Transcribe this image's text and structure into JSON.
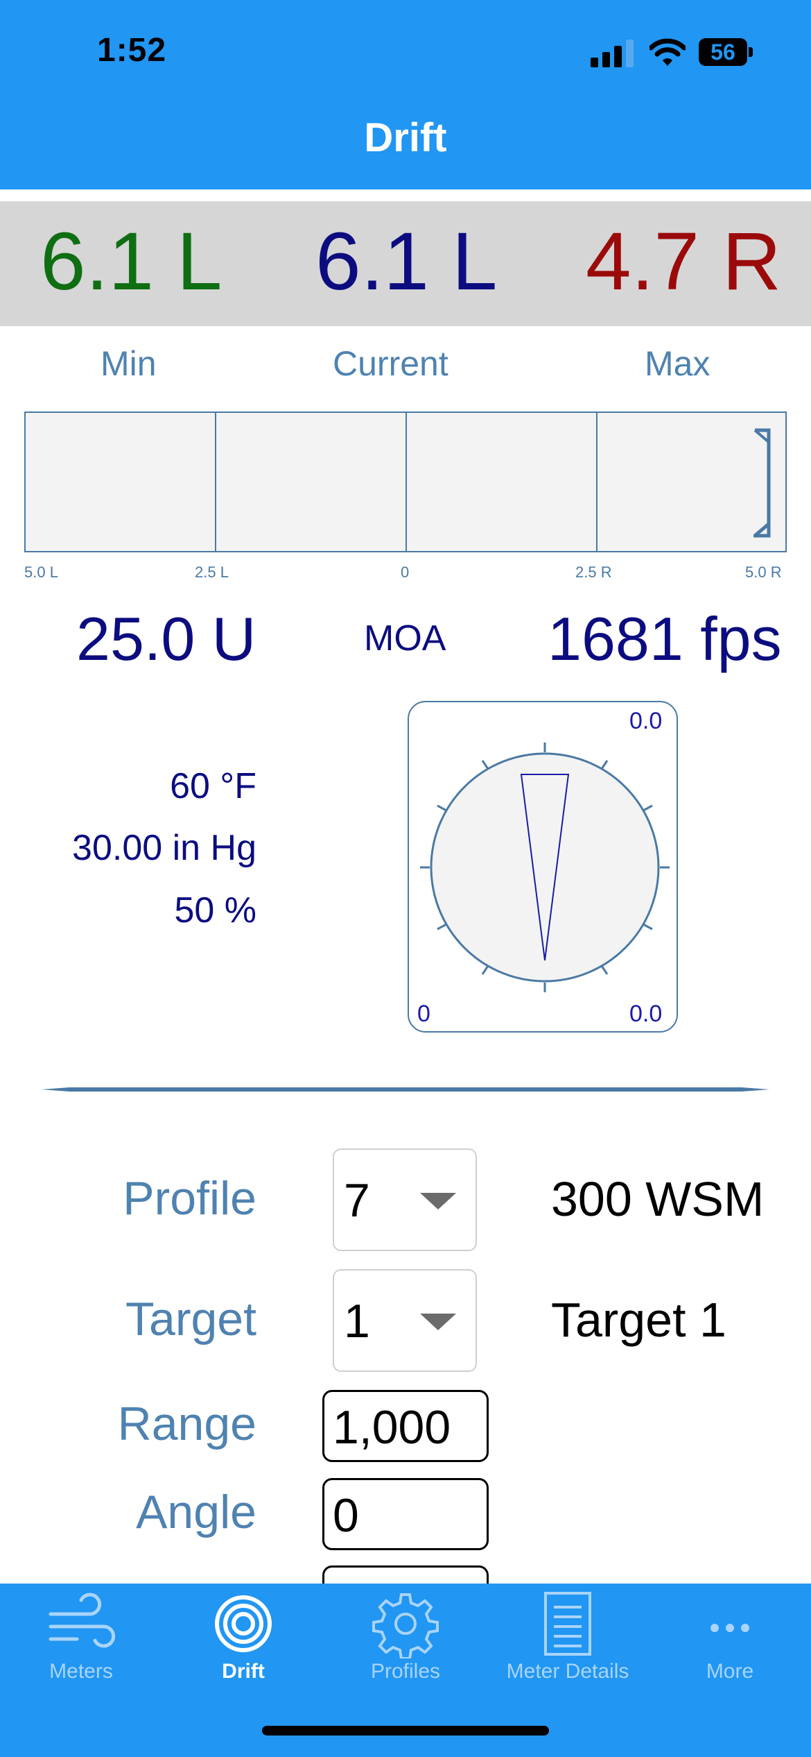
{
  "status": {
    "time": "1:52",
    "battery": "56"
  },
  "nav": {
    "title": "Drift"
  },
  "drift": {
    "min": "6.1 L",
    "current": "6.1 L",
    "max": "4.7 R",
    "labels": {
      "min": "Min",
      "current": "Current",
      "max": "Max"
    },
    "scale": [
      "5.0 L",
      "2.5 L",
      "0",
      "2.5 R",
      "5.0 R"
    ],
    "colors": {
      "min": "#0f6e12",
      "current": "#0c0c80",
      "max": "#9b0a0a"
    }
  },
  "elevation": "25.0 U",
  "units": "MOA",
  "velocity": "1681 fps",
  "atmosphere": {
    "temperature": "60 °F",
    "pressure": "30.00 in Hg",
    "humidity": "50 %"
  },
  "compass": {
    "top_right": "0.0",
    "bottom_left": "0",
    "bottom_right": "0.0"
  },
  "form": {
    "profile": {
      "label": "Profile",
      "value": "7",
      "name": "300 WSM"
    },
    "target": {
      "label": "Target",
      "value": "1",
      "name": "Target 1"
    },
    "range": {
      "label": "Range",
      "value": "1,000"
    },
    "angle": {
      "label": "Angle",
      "value": "0"
    }
  },
  "tabs": [
    {
      "label": "Meters",
      "icon": "wind-icon"
    },
    {
      "label": "Drift",
      "icon": "target-icon",
      "active": true
    },
    {
      "label": "Profiles",
      "icon": "gear-icon"
    },
    {
      "label": "Meter Details",
      "icon": "document-icon"
    },
    {
      "label": "More",
      "icon": "more-icon"
    }
  ]
}
